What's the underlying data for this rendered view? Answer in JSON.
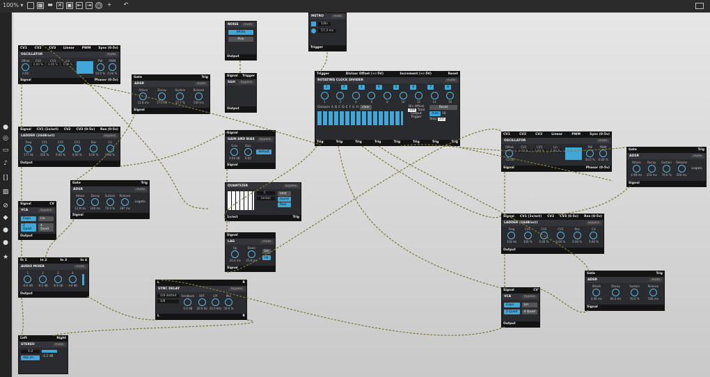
{
  "toolbar": {
    "zoom": "100%"
  },
  "modules": {
    "osc1": {
      "inputs": [
        "CV1",
        "CV2",
        "CV3",
        "Linear",
        "PWM",
        "Sync (0-5v)"
      ],
      "title": "OSCILLATOR",
      "tag": "mute",
      "knobs": [
        {
          "l": "Offset",
          "v": "0.00"
        },
        {
          "l": "CV2",
          "v": "0.00 %"
        },
        {
          "l": "CV3",
          "v": "0.00 %"
        },
        {
          "l": "Lin",
          "v": "0.00 %"
        },
        {
          "l": "PW",
          "v": "50.0 %"
        },
        {
          "l": "PWM",
          "v": "0.00 %"
        }
      ],
      "out_l": "Signal",
      "out_r": "Phasor (0-5v)"
    },
    "adsr1": {
      "inputs": [
        "Gate",
        "Trig"
      ],
      "title": "ADSR",
      "tag": "mute",
      "knobs": [
        {
          "l": "Attack",
          "v": "12.8 ms"
        },
        {
          "l": "Decay",
          "v": "173 ms"
        },
        {
          "l": "Sustain",
          "v": "37.7 %"
        },
        {
          "l": "Release",
          "v": "500 ms"
        }
      ],
      "out_l": "Signal",
      "out_r": ""
    },
    "noise": {
      "title": "NOISE",
      "tag": "mute",
      "opts": [
        "White",
        "Pink"
      ],
      "out_l": "Output"
    },
    "metro": {
      "title": "METRO",
      "tag": "mute",
      "tempo": "1/8n",
      "rate": "57.3 ms",
      "out_l": "Trigger"
    },
    "sh": {
      "inputs": [
        "Signal",
        "Trigger"
      ],
      "title": "S&H",
      "tag": "bypass",
      "out_l": "Output"
    },
    "clock": {
      "inputs": [
        "Trigger",
        "Divisor Offset (+/-5V)",
        "Increment (+/-5V)",
        "Reset"
      ],
      "title": "ROTATING CLOCK DIVIDER",
      "tag": "mute",
      "steps": [
        "1",
        "2",
        "3",
        "4",
        "5",
        "6",
        "7",
        "8"
      ],
      "divs": [
        "1",
        "2",
        "4",
        "6",
        "8",
        "10",
        "12",
        "14",
        "16"
      ],
      "divisors_label": "Divisors",
      "letters": [
        "A",
        "B",
        "C",
        "D",
        "E",
        "F",
        "G",
        "H"
      ],
      "clear": "clear",
      "offset_label": "Div Offset",
      "offset_val": "100",
      "offset_unit": "Total",
      "reset": "Reset",
      "auto": "Auto",
      "auto_val": "16",
      "step_label": "Step",
      "step_val": "3.0",
      "out_label": "Output",
      "trig_label": "Trigger",
      "outs": [
        "Trig",
        "Trig",
        "Trig",
        "Trig",
        "Trig",
        "Trig",
        "Trig",
        "Trig"
      ]
    },
    "ladder1": {
      "inputs": [
        "Signal",
        "CV1 (1v/oct)",
        "CV2",
        "CV3 (0-5v)",
        "Res (0-5v)"
      ],
      "title": "LADDER (24dB/oct)",
      "tag": "bypass",
      "knobs": [
        {
          "l": "Freq",
          "v": "177 Hz"
        },
        {
          "l": "CV1",
          "v": "100 %"
        },
        {
          "l": "CV2",
          "v": "0.00 %"
        },
        {
          "l": "CV3",
          "v": "0.00 %"
        },
        {
          "l": "Res",
          "v": "0.00 %"
        },
        {
          "l": "CV",
          "v": "0.00 %"
        }
      ],
      "out_l": "Output"
    },
    "gainbias": {
      "inputs": [
        "Signal"
      ],
      "title": "GAIN AND BIAS",
      "tag": "bypass",
      "knobs": [
        {
          "l": "Gain",
          "v": "0.00 dB"
        },
        {
          "l": "Bias",
          "v": "0.00"
        }
      ],
      "mode": "default",
      "out_l": "Signal"
    },
    "adsr2": {
      "inputs": [
        "Gate",
        "Trig"
      ],
      "title": "ADSR",
      "tag": "mute",
      "knobs": [
        {
          "l": "Attack",
          "v": "12.8 ms"
        },
        {
          "l": "Decay",
          "v": "146 ms"
        },
        {
          "l": "Sustain",
          "v": "70.0 %"
        },
        {
          "l": "Release",
          "v": "387 ms"
        }
      ],
      "extra": "Legato",
      "out_l": "Signal"
    },
    "quantizer": {
      "title": "QUANTIZER",
      "tag": "bypass",
      "key": "C",
      "scale": "ionian",
      "opts": [
        "near",
        "round",
        "floor"
      ],
      "out_l": "1v/oct",
      "out_r": "Trig"
    },
    "vca1": {
      "inputs": [
        "Signal",
        "CV"
      ],
      "title": "VCA",
      "tag": "bypass",
      "opts": [
        "Expo",
        "Lin",
        "2 Quad",
        "4 Quad"
      ],
      "out_l": "Output"
    },
    "lag": {
      "inputs": [
        "Signal"
      ],
      "title": "LAG",
      "tag": "mute",
      "knobs": [
        {
          "l": "Up",
          "v": "20.4 ms"
        },
        {
          "l": "Down",
          "v": "25.8 ms"
        }
      ],
      "opts": [
        "Lin",
        "Lg"
      ],
      "out_l": "Signal"
    },
    "mixer": {
      "inputs": [
        "In 1",
        "In 2",
        "In 3",
        "In 4"
      ],
      "title": "AUDIO MIXER",
      "tag": "mute",
      "knobs": [
        {
          "l": "1",
          "v": "-6.6 dB"
        },
        {
          "l": "2",
          "v": "-0.1 dB"
        },
        {
          "l": "3",
          "v": "-6.6 dB"
        },
        {
          "l": "4",
          "v": "-inf dB"
        }
      ],
      "out_l": "Output"
    },
    "delay": {
      "inputs": [
        "L",
        "R"
      ],
      "title": "SYNC DELAY",
      "tag": "bypass",
      "time1": "1/8 dotted",
      "time2": "1/8",
      "knobs": [
        {
          "l": "Feedback",
          "v": "0.0 dB"
        },
        {
          "l": "HPF",
          "v": "20.0 Hz"
        },
        {
          "l": "LPF",
          "v": "20.0 kHz"
        },
        {
          "l": "Mix",
          "v": "50.0 %"
        }
      ],
      "out_l": "L",
      "out_r": "R"
    },
    "stereo": {
      "inputs": [
        "Left",
        "Right"
      ],
      "title": "STEREO",
      "tag": "mute",
      "ch": "1-2",
      "pan": "dsp on",
      "lvl": "-3.2 dB"
    },
    "osc2": {
      "inputs": [
        "CV1",
        "CV2",
        "CV3",
        "Linear",
        "PWM",
        "Sync (0-5v)"
      ],
      "title": "OSCILLATOR",
      "tag": "mute",
      "knobs": [
        {
          "l": "Offset",
          "v": "-13.00"
        },
        {
          "l": "CV2",
          "v": "0.00 %"
        },
        {
          "l": "CV3",
          "v": "0.00 %"
        },
        {
          "l": "Lin",
          "v": "0.00 %"
        },
        {
          "l": "PW",
          "v": "50.0 %"
        },
        {
          "l": "PWM",
          "v": "0.00 %"
        }
      ],
      "out_l": "Signal",
      "out_r": "Phasor (0-5v)"
    },
    "adsr3": {
      "inputs": [
        "Gate",
        "Trig"
      ],
      "title": "ADSR",
      "tag": "mute",
      "knobs": [
        {
          "l": "Attack",
          "v": "4.98 ms"
        },
        {
          "l": "Decay",
          "v": "353 ms"
        },
        {
          "l": "Sustain",
          "v": "70.0 %"
        },
        {
          "l": "Release",
          "v": "500 ms"
        }
      ],
      "extra": "Legato",
      "out_l": "Signal"
    },
    "ladder2": {
      "inputs": [
        "Signal",
        "CV1 (1v/oct)",
        "CV2",
        "CV3 (0-5v)",
        "Res (0-5v)"
      ],
      "title": "LADDER (24dB/oct)",
      "tag": "bypass",
      "knobs": [
        {
          "l": "Freq",
          "v": "118 Hz"
        },
        {
          "l": "CV1",
          "v": "100 %"
        },
        {
          "l": "CV2",
          "v": "0.00 %"
        },
        {
          "l": "CV3",
          "v": "0.00 %"
        },
        {
          "l": "Res",
          "v": "0.00 %"
        },
        {
          "l": "CV",
          "v": "0.00 %"
        }
      ],
      "out_l": "Output"
    },
    "adsr4": {
      "inputs": [
        "Gate",
        "Trig"
      ],
      "title": "ADSR",
      "tag": "mute",
      "knobs": [
        {
          "l": "Attack",
          "v": "3.08 ms"
        },
        {
          "l": "Decay",
          "v": "84.0 ms"
        },
        {
          "l": "Sustain",
          "v": "70.0 %"
        },
        {
          "l": "Release",
          "v": "500 ms"
        }
      ],
      "out_l": "Signal"
    },
    "vca2": {
      "inputs": [
        "Signal",
        "CV"
      ],
      "title": "VCA",
      "tag": "bypass",
      "opts": [
        "Expo",
        "Lin",
        "2 Quad",
        "4 Quad"
      ],
      "out_l": "Output"
    }
  }
}
